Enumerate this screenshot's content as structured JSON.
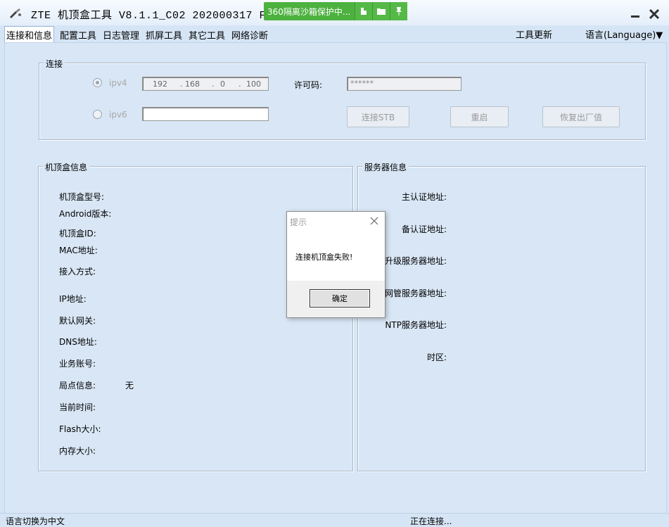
{
  "window": {
    "title": "ZTE 机顶盒工具 V8.1.1_C02 202000317 Fo",
    "sandbox_text": "360隔离沙箱保护中...",
    "minimize_label": "minimize",
    "close_label": "close"
  },
  "menu": {
    "items": [
      "连接和信息",
      "配置工具",
      "日志管理",
      "抓屏工具",
      "其它工具",
      "网络诊断"
    ],
    "update": "工具更新",
    "language": "语言(Language)▼"
  },
  "connection": {
    "group_title": "连接",
    "ipv4_label": "ipv4",
    "ipv6_label": "ipv6",
    "ip": [
      "192",
      "168",
      "0",
      "100"
    ],
    "license_label": "许可码:",
    "license_value": "******",
    "connect_button": "连接STB",
    "reboot_button": "重启",
    "factory_reset_button": "恢复出厂值"
  },
  "stb_info": {
    "group_title": "机顶盒信息",
    "fields": [
      {
        "label": "机顶盒型号:",
        "value": ""
      },
      {
        "label": "Android版本:",
        "value": ""
      },
      {
        "label": "机顶盒ID:",
        "value": ""
      },
      {
        "label": "MAC地址:",
        "value": ""
      },
      {
        "label": "接入方式:",
        "value": ""
      },
      {
        "label": "IP地址:",
        "value": ""
      },
      {
        "label": "默认网关:",
        "value": ""
      },
      {
        "label": "DNS地址:",
        "value": ""
      },
      {
        "label": "业务账号:",
        "value": ""
      },
      {
        "label": "局点信息:",
        "value": "无"
      },
      {
        "label": "当前时间:",
        "value": ""
      },
      {
        "label": "Flash大小:",
        "value": ""
      },
      {
        "label": "内存大小:",
        "value": ""
      }
    ]
  },
  "server_info": {
    "group_title": "服务器信息",
    "fields": [
      {
        "label": "主认证地址:"
      },
      {
        "label": "备认证地址:"
      },
      {
        "label": "升级服务器地址:"
      },
      {
        "label": "网管服务器地址:"
      },
      {
        "label": "NTP服务器地址:"
      },
      {
        "label": "时区:"
      }
    ]
  },
  "dialog": {
    "title": "提示",
    "message": "连接机顶盒失败!",
    "ok_button": "确定"
  },
  "status": {
    "left": "语言切换为中文",
    "center": "正在连接..."
  }
}
